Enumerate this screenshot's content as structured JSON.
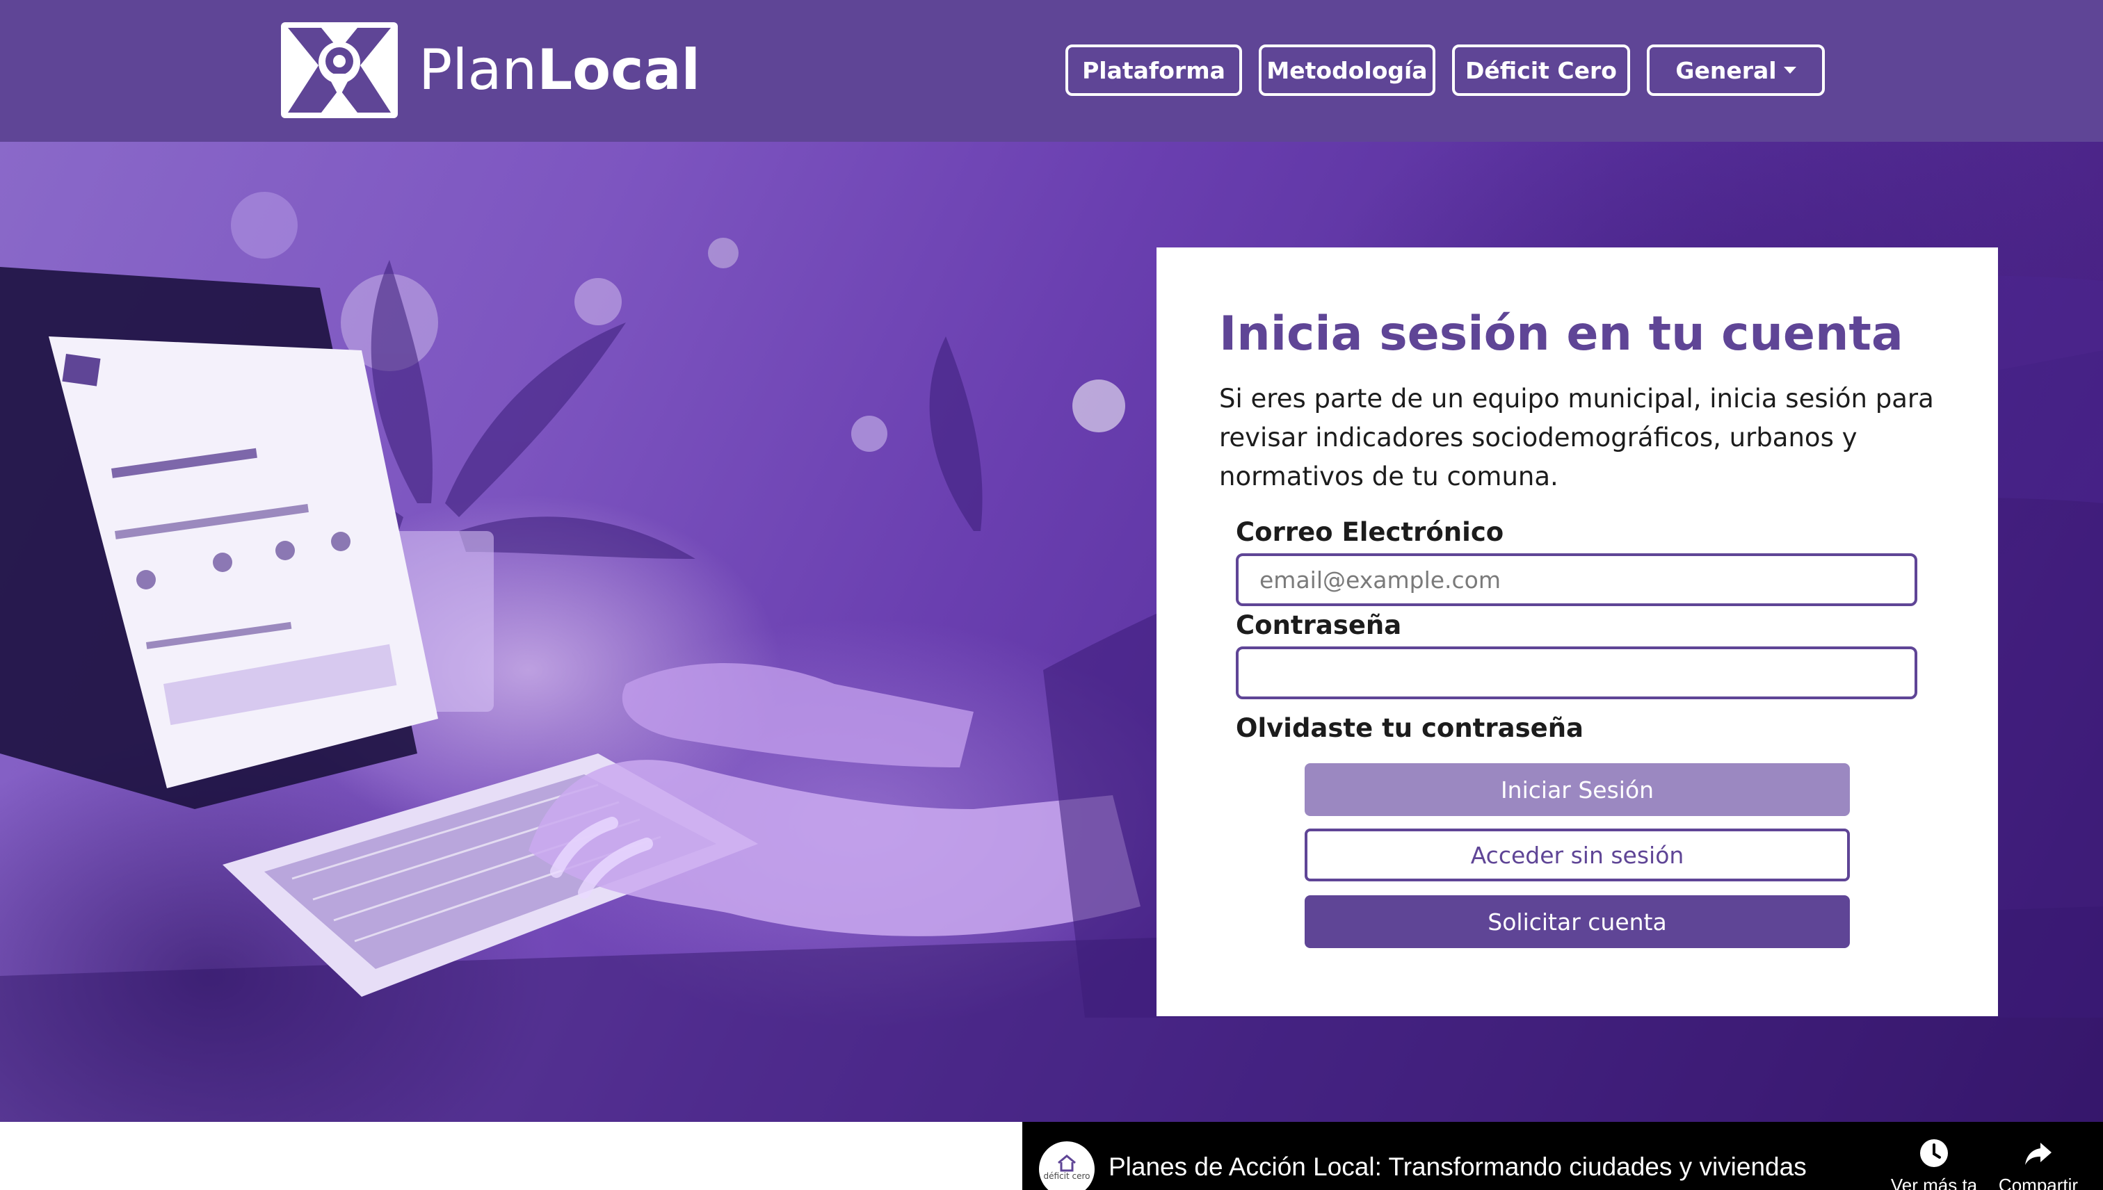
{
  "brand": {
    "name_light": "Plan",
    "name_bold": "Local",
    "logo_icon": "map-pin-logo-icon",
    "primary_color": "#5f4596"
  },
  "nav": {
    "items": [
      {
        "label": "Plataforma"
      },
      {
        "label": "Metodología"
      },
      {
        "label": "Déficit Cero"
      },
      {
        "label": "General",
        "icon": "caret-down-icon"
      }
    ]
  },
  "login": {
    "title": "Inicia sesión en tu cuenta",
    "description": "Si eres parte de un equipo municipal, inicia sesión para revisar indicadores sociodemográficos, urbanos y normativos de tu comuna.",
    "email_label": "Correo Electrónico",
    "email_placeholder": "email@example.com",
    "email_value": "",
    "password_label": "Contraseña",
    "password_value": "",
    "forgot_label": "Olvidaste tu contraseña",
    "login_button": "Iniciar Sesión",
    "guest_button": "Acceder sin sesión",
    "request_button": "Solicitar cuenta"
  },
  "video": {
    "title": "Planes de Acción Local: Transformando ciudades y viviendas",
    "channel_avatar_text": "déficit cero",
    "actions": [
      {
        "label": "Ver más ta",
        "icon": "clock-icon"
      },
      {
        "label": "Compartir",
        "icon": "share-icon"
      }
    ]
  }
}
